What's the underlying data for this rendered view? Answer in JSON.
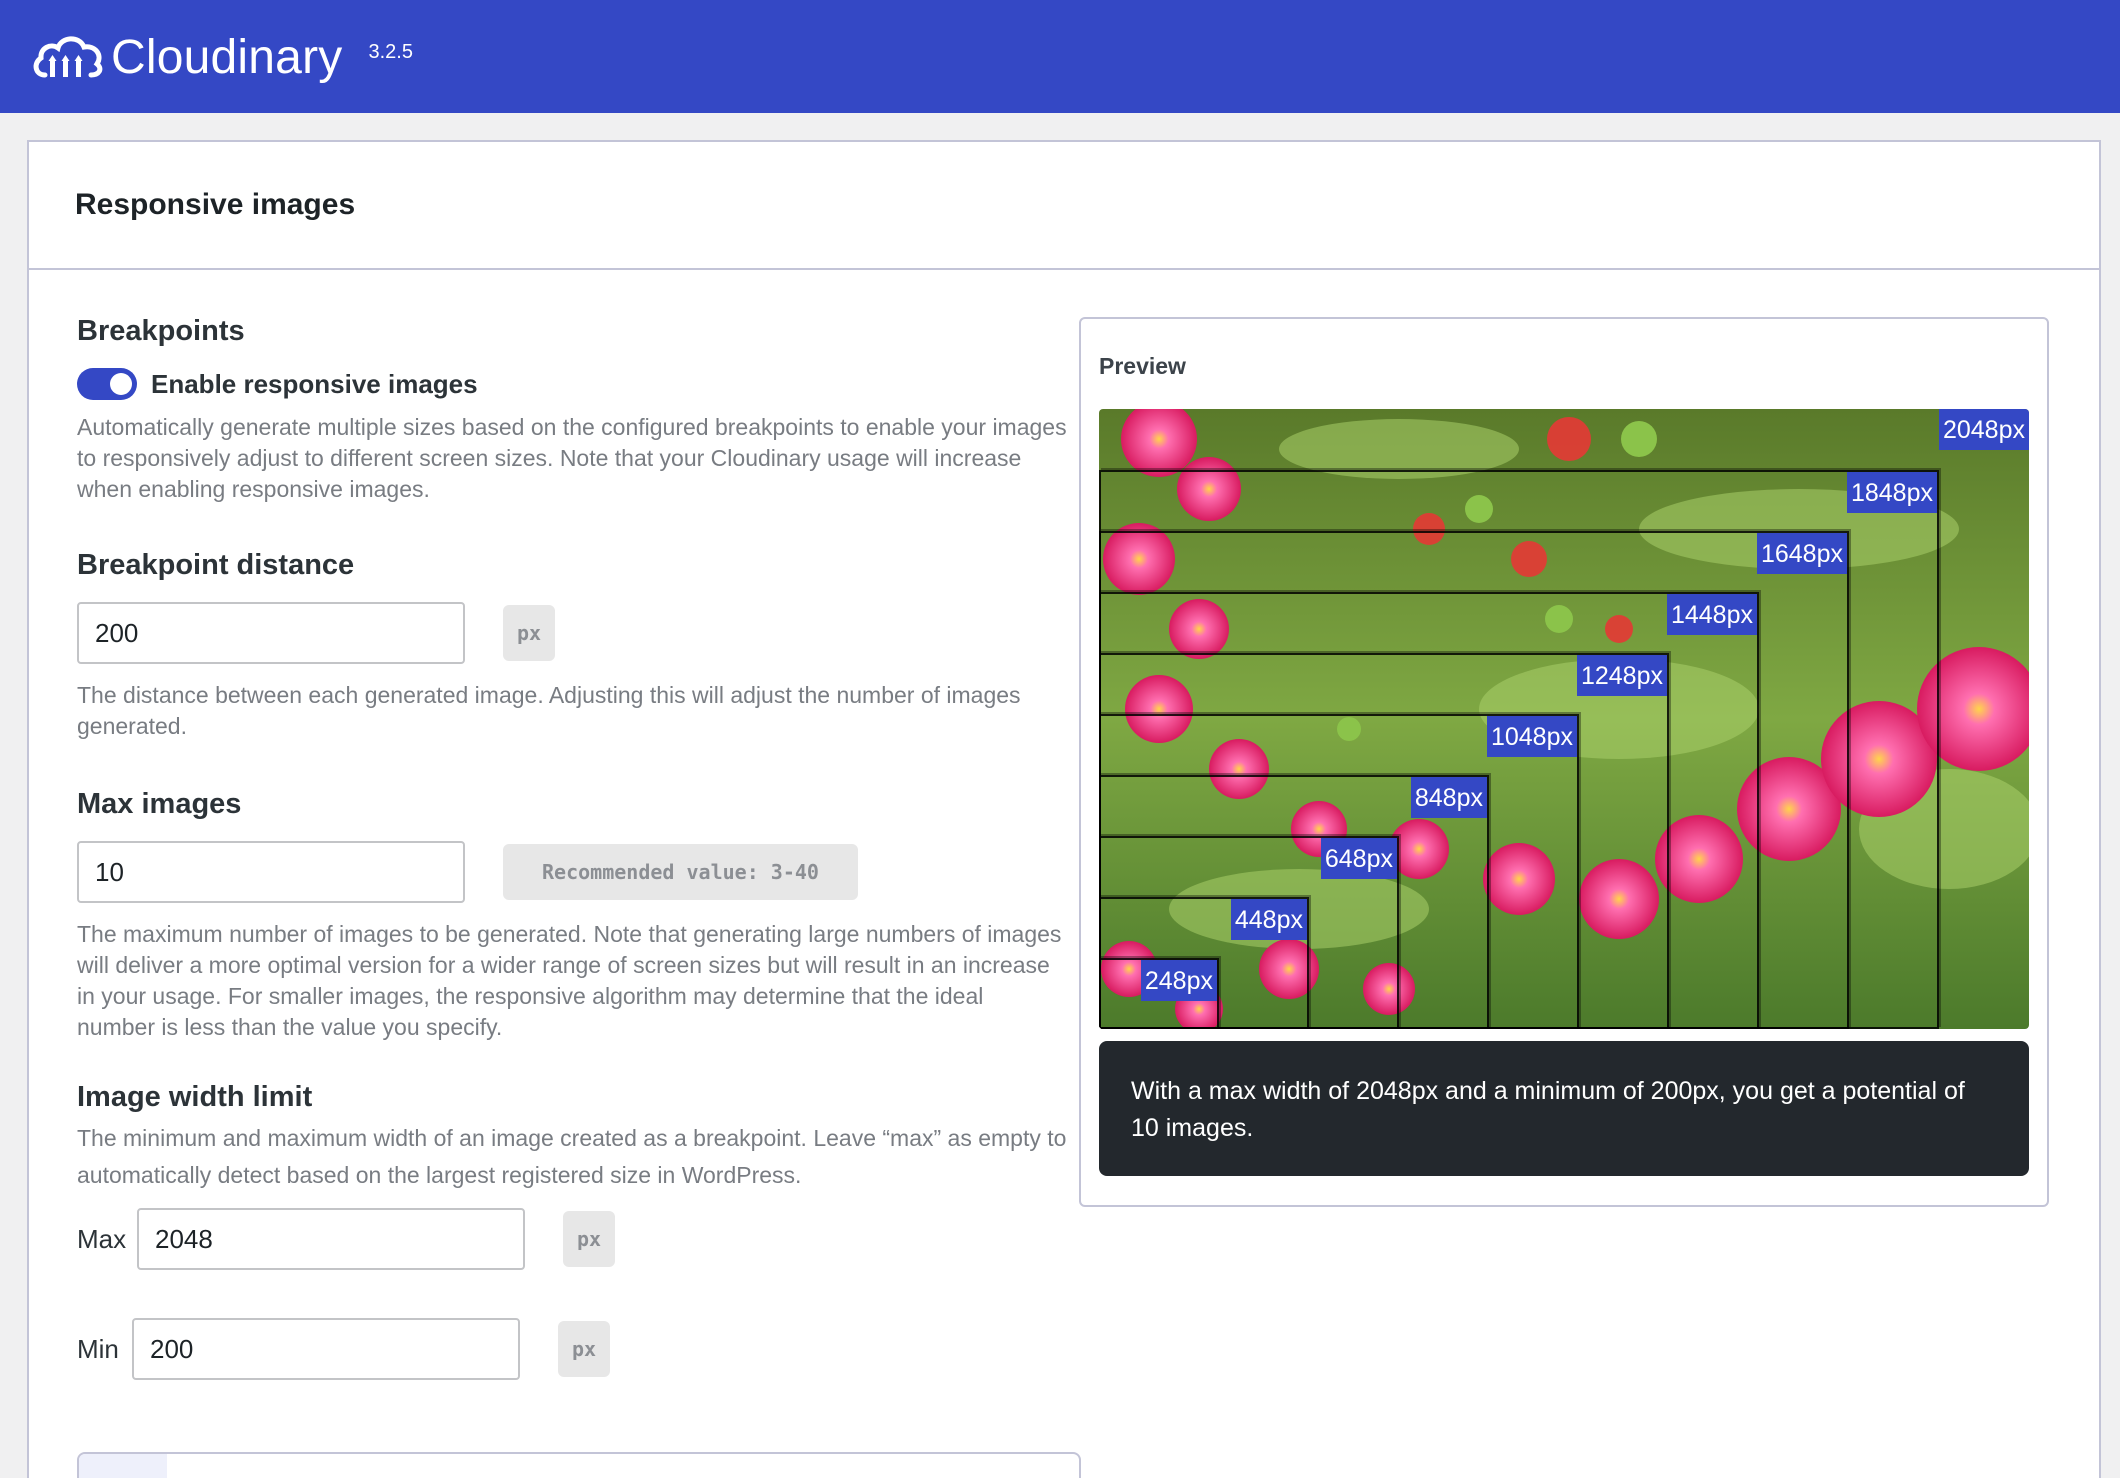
{
  "header": {
    "brand": "Cloudinary",
    "version": "3.2.5",
    "background_color": "#3448c5"
  },
  "panel": {
    "title": "Responsive images"
  },
  "breakpoints": {
    "title": "Breakpoints",
    "toggle_label": "Enable responsive images",
    "toggle_on": true,
    "description": "Automatically generate multiple sizes based on the configured breakpoints to enable your images to responsively adjust to different screen sizes. Note that your Cloudinary usage will increase when enabling responsive images."
  },
  "breakpoint_distance": {
    "title": "Breakpoint distance",
    "value": "200",
    "unit": "px",
    "description": "The distance between each generated image. Adjusting this will adjust the number of images generated."
  },
  "max_images": {
    "title": "Max images",
    "value": "10",
    "hint": "Recommended value: 3-40",
    "description": "The maximum number of images to be generated. Note that generating large numbers of images will deliver a more optimal version for a wider range of screen sizes but will result in an increase in your usage. For smaller images, the responsive algorithm may determine that the ideal number is less than the value you specify."
  },
  "image_width_limit": {
    "title": "Image width limit",
    "description": "The minimum and maximum width of an image created as a breakpoint. Leave “max” as empty to automatically detect based on the largest registered size in WordPress.",
    "max_label": "Max",
    "max_value": "2048",
    "max_unit": "px",
    "min_label": "Min",
    "min_value": "200",
    "min_unit": "px"
  },
  "preview": {
    "title": "Preview",
    "breakpoints": [
      "2048px",
      "1848px",
      "1648px",
      "1448px",
      "1248px",
      "1048px",
      "848px",
      "648px",
      "448px",
      "248px"
    ],
    "caption": "With a max width of 2048px and a minimum of 200px, you get a potential of 10 images.",
    "label_color": "#3448c5",
    "caption_background": "#23282d"
  }
}
